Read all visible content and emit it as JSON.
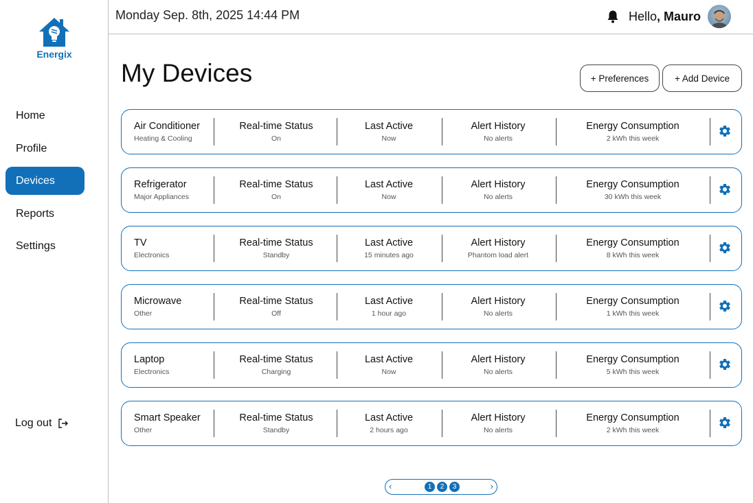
{
  "brand": {
    "name": "Energix",
    "color": "#1270b8"
  },
  "header": {
    "datetime": "Monday  Sep. 8th, 2025  14:44 PM",
    "greeting": "Hello",
    "user_name": ", Mauro"
  },
  "nav": {
    "items": [
      {
        "label": "Home",
        "active": false
      },
      {
        "label": "Profile",
        "active": false
      },
      {
        "label": "Devices",
        "active": true
      },
      {
        "label": "Reports",
        "active": false
      },
      {
        "label": "Settings",
        "active": false
      }
    ],
    "logout_label": "Log out"
  },
  "page": {
    "title": "My Devices",
    "preferences_label": "+ Preferences",
    "add_device_label": "+ Add Device"
  },
  "columns": {
    "status": "Real-time Status",
    "last_active": "Last Active",
    "alerts": "Alert History",
    "energy": "Energy Consumption"
  },
  "devices": [
    {
      "name": "Air Conditioner",
      "category": "Heating & Cooling",
      "status": "On",
      "last_active": "Now",
      "alerts": "No alerts",
      "energy": "2 kWh this week"
    },
    {
      "name": "Refrigerator",
      "category": "Major Appliances",
      "status": "On",
      "last_active": "Now",
      "alerts": "No alerts",
      "energy": "30 kWh this week"
    },
    {
      "name": "TV",
      "category": "Electronics",
      "status": "Standby",
      "last_active": "15 minutes ago",
      "alerts": "Phantom load alert",
      "energy": "8 kWh this week"
    },
    {
      "name": "Microwave",
      "category": "Other",
      "status": "Off",
      "last_active": "1 hour ago",
      "alerts": "No alerts",
      "energy": "1 kWh this week"
    },
    {
      "name": "Laptop",
      "category": "Electronics",
      "status": "Charging",
      "last_active": "Now",
      "alerts": "No alerts",
      "energy": "5 kWh this week"
    },
    {
      "name": "Smart Speaker",
      "category": "Other",
      "status": "Standby",
      "last_active": "2 hours ago",
      "alerts": "No alerts",
      "energy": "2 kWh this week"
    }
  ],
  "pagination": {
    "prev": "‹",
    "next": "›",
    "pages": [
      "1",
      "2",
      "3"
    ],
    "current": "1"
  },
  "icons": {
    "logo": "house-bulb-icon",
    "bell": "bell-icon",
    "logout": "logout-icon",
    "gear": "gear-icon"
  }
}
